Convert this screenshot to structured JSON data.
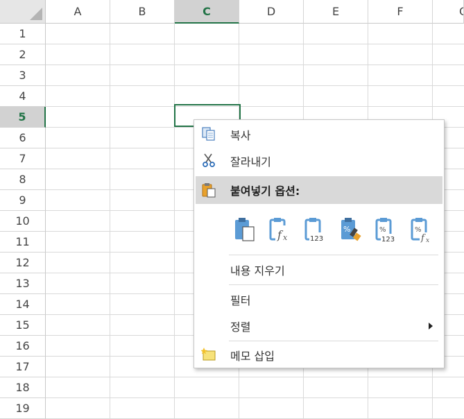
{
  "columns": [
    "A",
    "B",
    "C",
    "D",
    "E",
    "F",
    "G"
  ],
  "selected_column": "C",
  "rows": [
    "1",
    "2",
    "3",
    "4",
    "5",
    "6",
    "7",
    "8",
    "9",
    "10",
    "11",
    "12",
    "13",
    "14",
    "15",
    "16",
    "17",
    "18",
    "19"
  ],
  "selected_row": "5",
  "context_menu": {
    "copy": {
      "label": "복사",
      "icon": "copy-icon"
    },
    "cut": {
      "label": "잘라내기",
      "icon": "scissors-icon"
    },
    "paste_options": {
      "label": "붙여넣기 옵션:",
      "icon": "clipboard-icon",
      "buttons": [
        "paste",
        "paste-formulas",
        "paste-values",
        "paste-formatting",
        "paste-values-number-format",
        "paste-formulas-number-format"
      ]
    },
    "clear_contents": {
      "label": "내용 지우기"
    },
    "filter": {
      "label": "필터"
    },
    "sort": {
      "label": "정렬"
    },
    "insert_comment": {
      "label": "메모 삽입",
      "icon": "comment-icon"
    }
  },
  "colors": {
    "accent": "#217346",
    "highlight": "#d9d9d9",
    "icon_blue": "#5b9bd5"
  }
}
